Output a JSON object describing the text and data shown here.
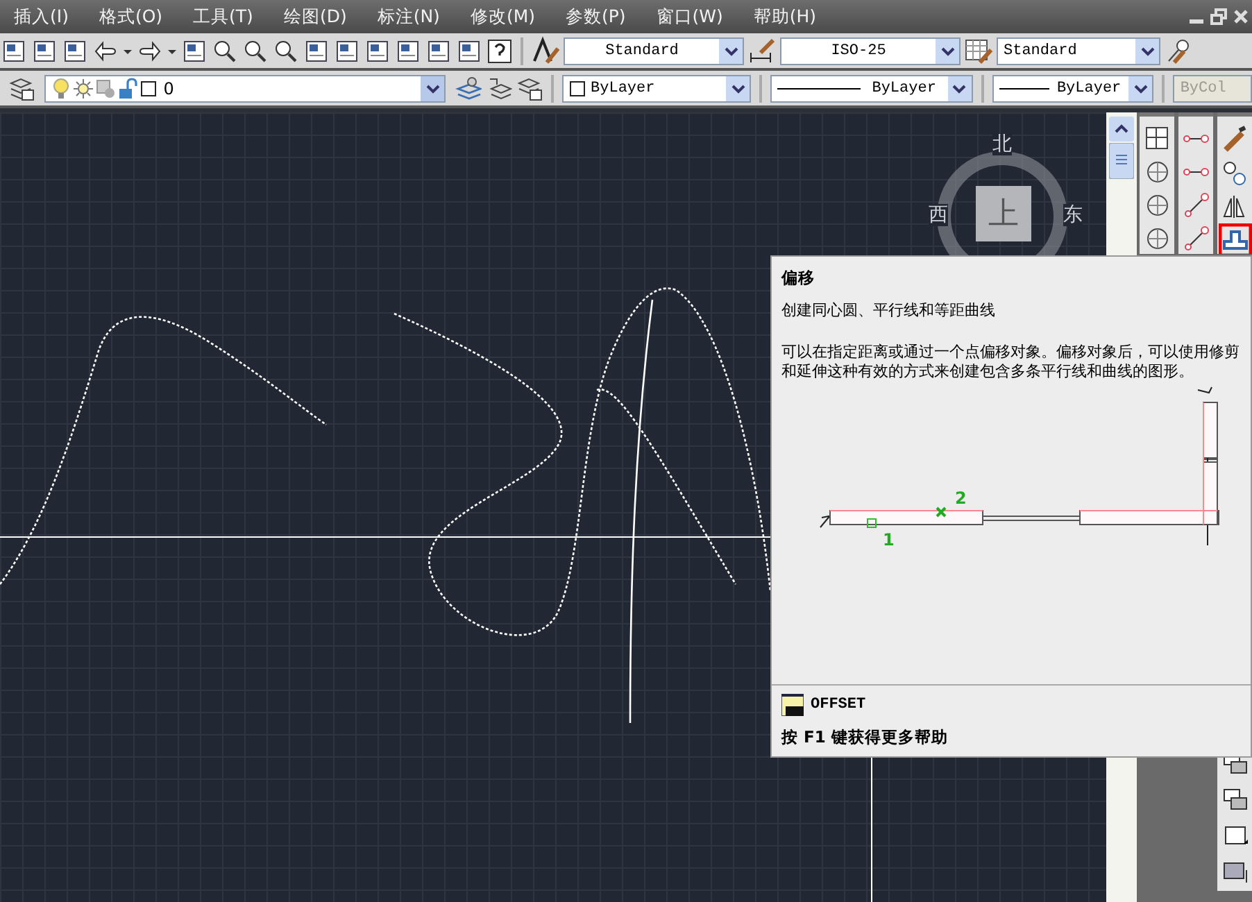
{
  "menu_bar": {
    "items": [
      "插入(I)",
      "格式(O)",
      "工具(T)",
      "绘图(D)",
      "标注(N)",
      "修改(M)",
      "参数(P)",
      "窗口(W)",
      "帮助(H)"
    ]
  },
  "styles_toolbar": {
    "text_style": "Standard",
    "dimension_style": "ISO-25",
    "table_style": "Standard"
  },
  "layers_toolbar": {
    "layer": "0"
  },
  "properties_toolbar": {
    "color_setting": "ByLayer",
    "linetype": "ByLayer",
    "lineweight": "ByLayer",
    "plot_style": "ByCol",
    "plot_style_disabled": true
  },
  "view_cube": {
    "north": "北",
    "west": "西",
    "east": "东",
    "face": "上"
  },
  "modify_toolbar": [
    {
      "kind": "erase",
      "highlighted": false
    },
    {
      "kind": "copy",
      "highlighted": false
    },
    {
      "kind": "mirror",
      "highlighted": false
    },
    {
      "kind": "offset",
      "highlighted": true
    }
  ],
  "tooltip": {
    "title": "偏移",
    "summary": "创建同心圆、平行线和等距曲线",
    "description": "可以在指定距离或通过一个点偏移对象。偏移对象后，可以使用修剪和延伸这种有效的方式来创建包含多条平行线和曲线的图形。",
    "point_labels": [
      "1",
      "2"
    ],
    "command": "OFFSET",
    "help": "按 F1 键获得更多帮助"
  }
}
